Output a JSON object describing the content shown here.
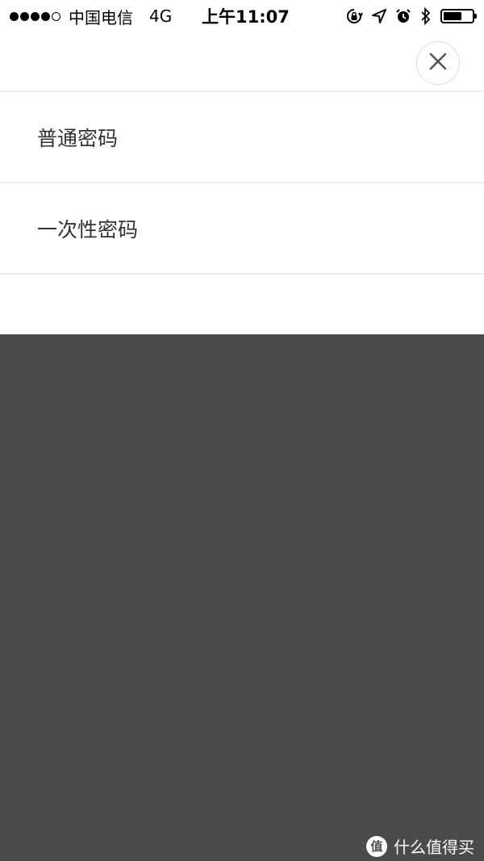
{
  "status_bar": {
    "carrier": "中国电信",
    "network": "4G",
    "time": "上午11:07",
    "signal_bars_filled": 4,
    "signal_bars_total": 5,
    "battery_level": 0.65,
    "icons": [
      "orientation-lock-icon",
      "location-arrow-icon",
      "alarm-icon",
      "bluetooth-icon",
      "battery-icon"
    ]
  },
  "sheet": {
    "close_icon": "close-icon",
    "options": [
      {
        "label": "普通密码"
      },
      {
        "label": "一次性密码"
      }
    ]
  },
  "watermark": {
    "text": "什么值得买",
    "logo_glyph": "值"
  },
  "colors": {
    "overlay": "#4b4b4b",
    "sheet_bg": "#ffffff",
    "divider": "#ececec",
    "option_text": "#333333"
  }
}
